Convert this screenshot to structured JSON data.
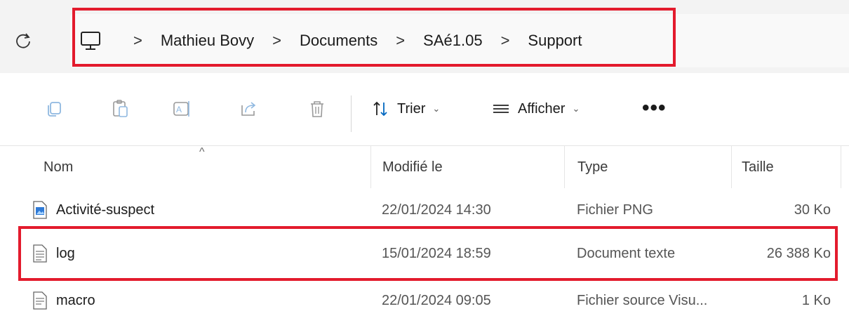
{
  "breadcrumb": {
    "items": [
      "Mathieu Bovy",
      "Documents",
      "SAé1.05",
      "Support"
    ],
    "separator": ">"
  },
  "toolbar": {
    "sort_label": "Trier",
    "view_label": "Afficher",
    "more_label": "•••",
    "chevron": "⌄"
  },
  "columns": {
    "name": "Nom",
    "modified": "Modifié le",
    "type": "Type",
    "size": "Taille",
    "sort_indicator": "^"
  },
  "files": [
    {
      "name": "Activité-suspect",
      "modified": "22/01/2024 14:30",
      "type": "Fichier PNG",
      "size": "30 Ko",
      "icon": "png-file-icon"
    },
    {
      "name": "log",
      "modified": "15/01/2024 18:59",
      "type": "Document texte",
      "size": "26 388 Ko",
      "icon": "text-file-icon"
    },
    {
      "name": "macro",
      "modified": "22/01/2024 09:05",
      "type": "Fichier source Visu...",
      "size": "1 Ko",
      "icon": "source-file-icon"
    }
  ],
  "colors": {
    "highlight": "#e31b2d",
    "accent": "#0067c0"
  }
}
